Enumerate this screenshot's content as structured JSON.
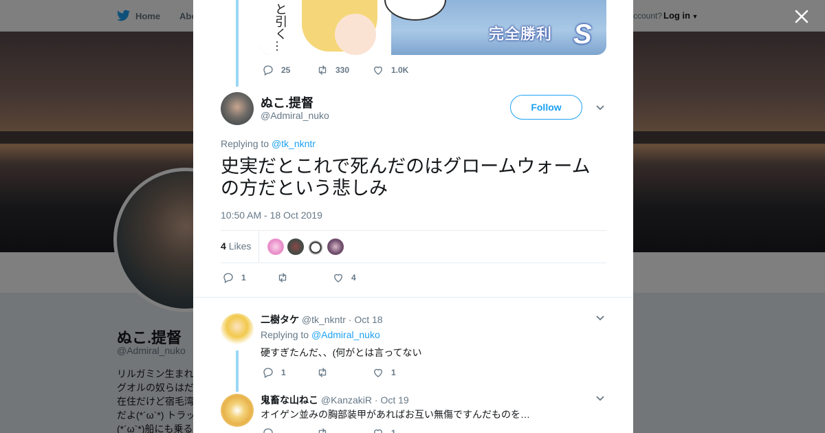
{
  "topbar": {
    "home_label": "Home",
    "about_label": "Abo",
    "account_prompt": "ccount?",
    "login_label": "Log in"
  },
  "profile": {
    "name": "ぬこ.提督",
    "handle": "@Admiral_nuko",
    "bio_lines": [
      "リルガミン生まれ",
      "グオルの奴らはだ",
      "在住だけど宿毛湾",
      "だよ(*´ω`*) トラッ",
      "(*´ω`*)船にも乗る"
    ]
  },
  "modal": {
    "media": {
      "vertical_text": "と引く…",
      "victory_text": "完全勝利",
      "rank": "S"
    },
    "parent_tweet_stats": {
      "replies": "25",
      "retweets": "330",
      "likes": "1.0K"
    },
    "tweet": {
      "author_name": "ぬこ.提督",
      "author_handle": "@Admiral_nuko",
      "follow_label": "Follow",
      "replying_prefix": "Replying to",
      "replying_to": "@tk_nkntr",
      "text": "史実だとこれで死んだのはグロームウォームの方だという悲しみ",
      "timestamp": "10:50 AM - 18 Oct 2019",
      "likes_count": "4",
      "likes_label": "Likes",
      "stats": {
        "replies": "1",
        "retweets": "",
        "likes": "4"
      }
    },
    "replies": [
      {
        "name": "二樹タケ",
        "handle": "@tk_nkntr",
        "date": "· Oct 18",
        "replying_prefix": "Replying to",
        "replying_to": "@Admiral_nuko",
        "text": "硬すぎたんだ、、(何がとは言ってない",
        "stats": {
          "replies": "1",
          "retweets": "",
          "likes": "1"
        }
      },
      {
        "name": "鬼畜な山ねこ",
        "handle": "@KanzakiR",
        "date": "· Oct 19",
        "text": "オイゲン並みの胸部装甲があればお互い無傷ですんだものを…",
        "stats": {
          "replies": "",
          "retweets": "",
          "likes": "1"
        }
      }
    ]
  },
  "colors": {
    "accent": "#1da1f2",
    "thread_line": "#9ad7f5",
    "muted_text": "#657786",
    "overlay": "rgba(0,0,0,0.5)"
  }
}
